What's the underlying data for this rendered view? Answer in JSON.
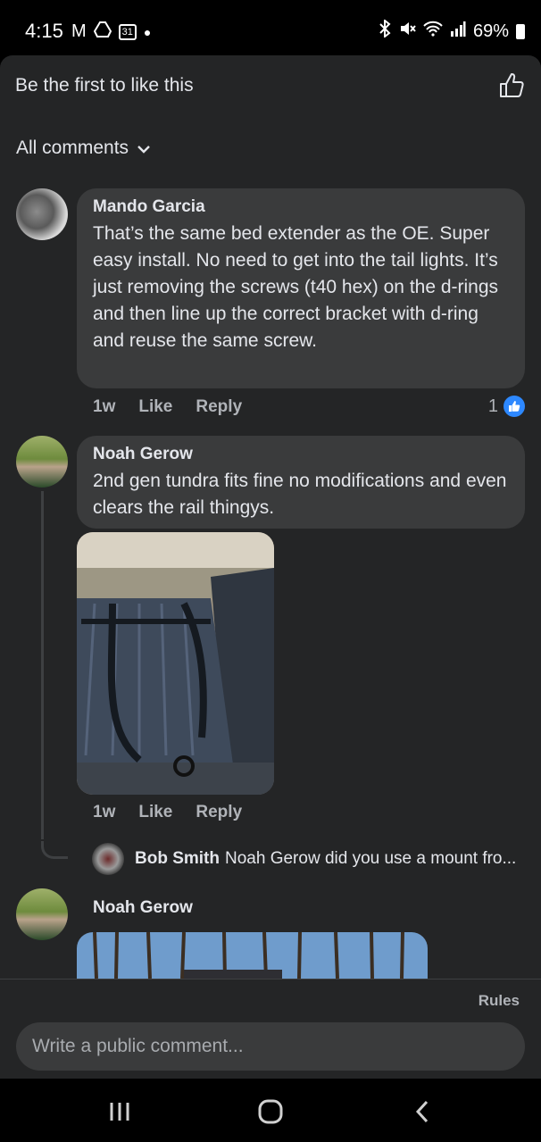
{
  "status_bar": {
    "time": "4:15",
    "calendar_day": "31",
    "battery": "69%",
    "icons": [
      "gmail-icon",
      "drive-icon",
      "calendar-icon",
      "dot-icon",
      "bluetooth-icon",
      "mute-icon",
      "wifi-icon",
      "signal-icon",
      "battery-icon"
    ]
  },
  "header": {
    "likes_text": "Be the first to like this",
    "filter_label": "All comments"
  },
  "comments": [
    {
      "author": "Mando Garcia",
      "text": "That’s the same bed extender as the OE. Super easy install. No need to get into the tail lights. It’s just removing the screws (t40 hex) on the d-rings and then line up the correct bracket with d-ring and reuse the same screw.",
      "time": "1w",
      "like_label": "Like",
      "reply_label": "Reply",
      "reaction_count": "1"
    },
    {
      "author": "Noah Gerow",
      "text": "2nd gen tundra fits fine no modifications and even clears the rail thingys.",
      "time": "1w",
      "like_label": "Like",
      "reply_label": "Reply",
      "reply": {
        "author": "Bob Smith",
        "text": "Noah Gerow did you use a mount fro..."
      }
    },
    {
      "author": "Noah Gerow"
    }
  ],
  "composer": {
    "rules_label": "Rules",
    "placeholder": "Write a public comment..."
  },
  "colors": {
    "panel_bg": "#242526",
    "bubble_bg": "#3a3b3c",
    "text": "#e4e6eb",
    "secondary_text": "#b0b3b8",
    "like_blue": "#2d88ff"
  }
}
